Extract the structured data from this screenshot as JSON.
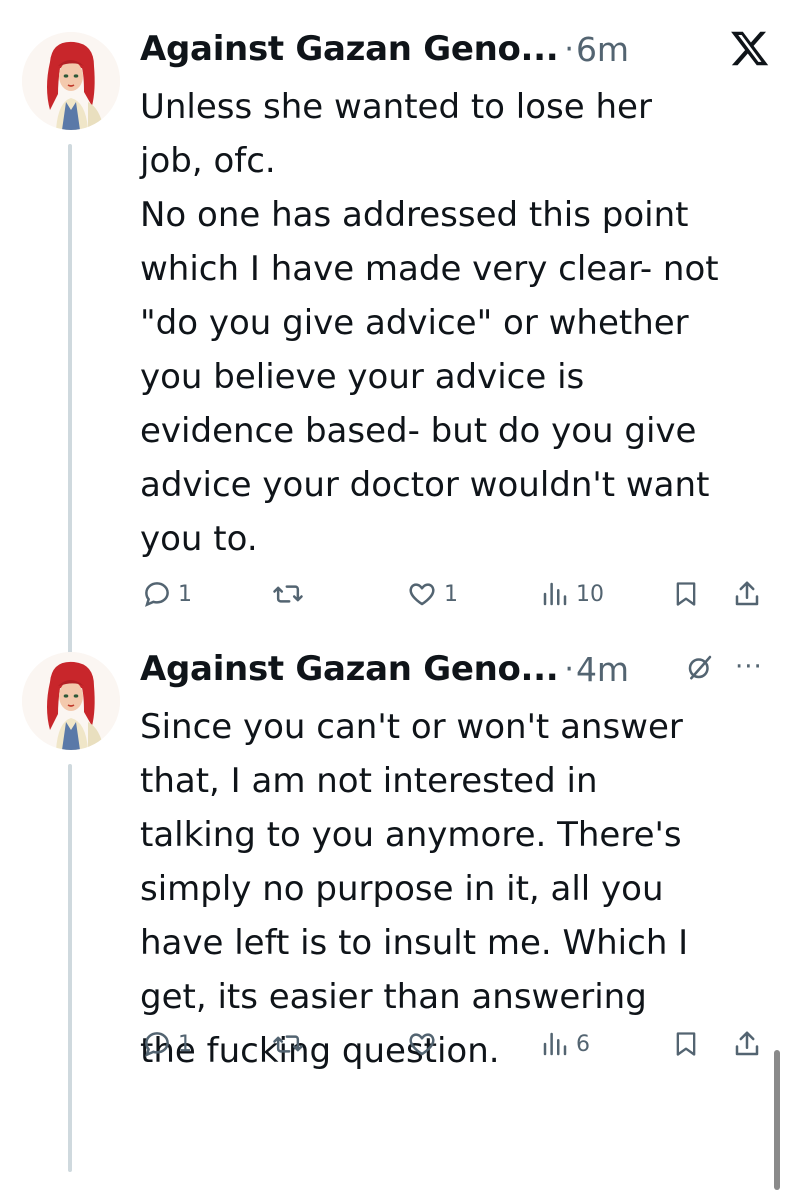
{
  "tweets": [
    {
      "author": "Against Gazan Geno...",
      "separator": "·",
      "time": "6m",
      "text": "Unless she wanted to lose her\njob, ofc.\nNo one has addressed this point\nwhich I have made very clear- not\n\"do you give advice\" or whether\nyou believe your advice is\nevidence based- but do you give\nadvice your doctor wouldn't want\nyou to.",
      "replies": "1",
      "likes": "1",
      "views": "10",
      "header_icon": "x-logo-icon"
    },
    {
      "author": "Against Gazan Geno...",
      "separator": "·",
      "time": "4m",
      "text": "Since you can't or won't answer\nthat, I am not interested in\ntalking to you anymore. There's\nsimply no purpose in it, all you\nhave left is to insult me. Which I\nget, its easier than answering\nthe fucking question.",
      "replies": "1",
      "likes": "",
      "views": "6",
      "header_icon": "grok-icon",
      "more_label": "···"
    }
  ],
  "colors": {
    "text": "#0f1419",
    "secondary": "#536471",
    "thread_line": "#cfd9de"
  }
}
